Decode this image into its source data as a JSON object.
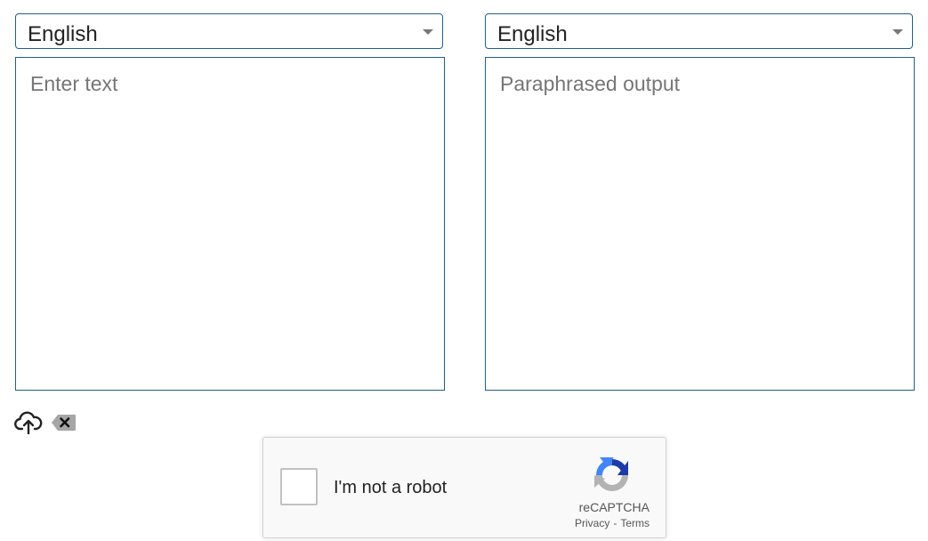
{
  "source_language": {
    "selected": "English"
  },
  "target_language": {
    "selected": "English"
  },
  "input_box": {
    "placeholder": "Enter text",
    "value": ""
  },
  "output_box": {
    "placeholder": "Paraphrased output",
    "value": ""
  },
  "toolbar": {
    "upload_icon": "cloud-upload-icon",
    "clear_icon": "backspace-clear-icon"
  },
  "captcha": {
    "label": "I'm not a robot",
    "brand": "reCAPTCHA",
    "privacy": "Privacy",
    "separator": "-",
    "terms": "Terms",
    "logo_icon": "recaptcha-logo-icon",
    "colors": {
      "blue_dark": "#1c3aa9",
      "blue_light": "#4285f4",
      "gray": "#b3b3b3"
    }
  },
  "colors": {
    "border_accent": "#1f5f8b",
    "placeholder": "#767676"
  }
}
